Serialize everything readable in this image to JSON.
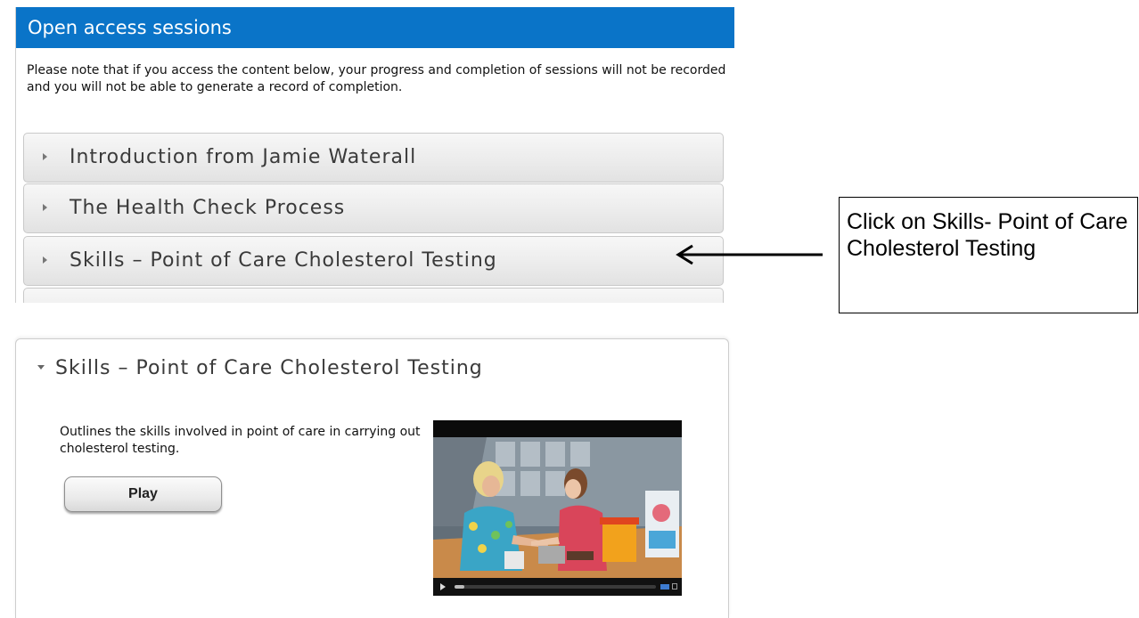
{
  "open_access": {
    "title": "Open access sessions",
    "notice": "Please note that if you access the content below, your progress and completion of sessions will not be recorded and you will not be able to generate a record of completion.",
    "sessions": [
      {
        "label": "Introduction from Jamie Waterall"
      },
      {
        "label": "The Health Check Process"
      },
      {
        "label": "Skills – Point of Care Cholesterol Testing"
      },
      {
        "label": ""
      }
    ]
  },
  "callout": {
    "text": "Click on Skills- Point of Care Cholesterol Testing"
  },
  "expanded_session": {
    "title": "Skills – Point of Care Cholesterol Testing",
    "description": "Outlines the skills involved in point of care in carrying out cholesterol testing.",
    "play_label": "Play",
    "video": {
      "progress": 0.05,
      "controls_accent": "#3d7bd0"
    }
  },
  "colors": {
    "header_blue": "#0a74c8",
    "accordion_bg": "#ececec"
  }
}
